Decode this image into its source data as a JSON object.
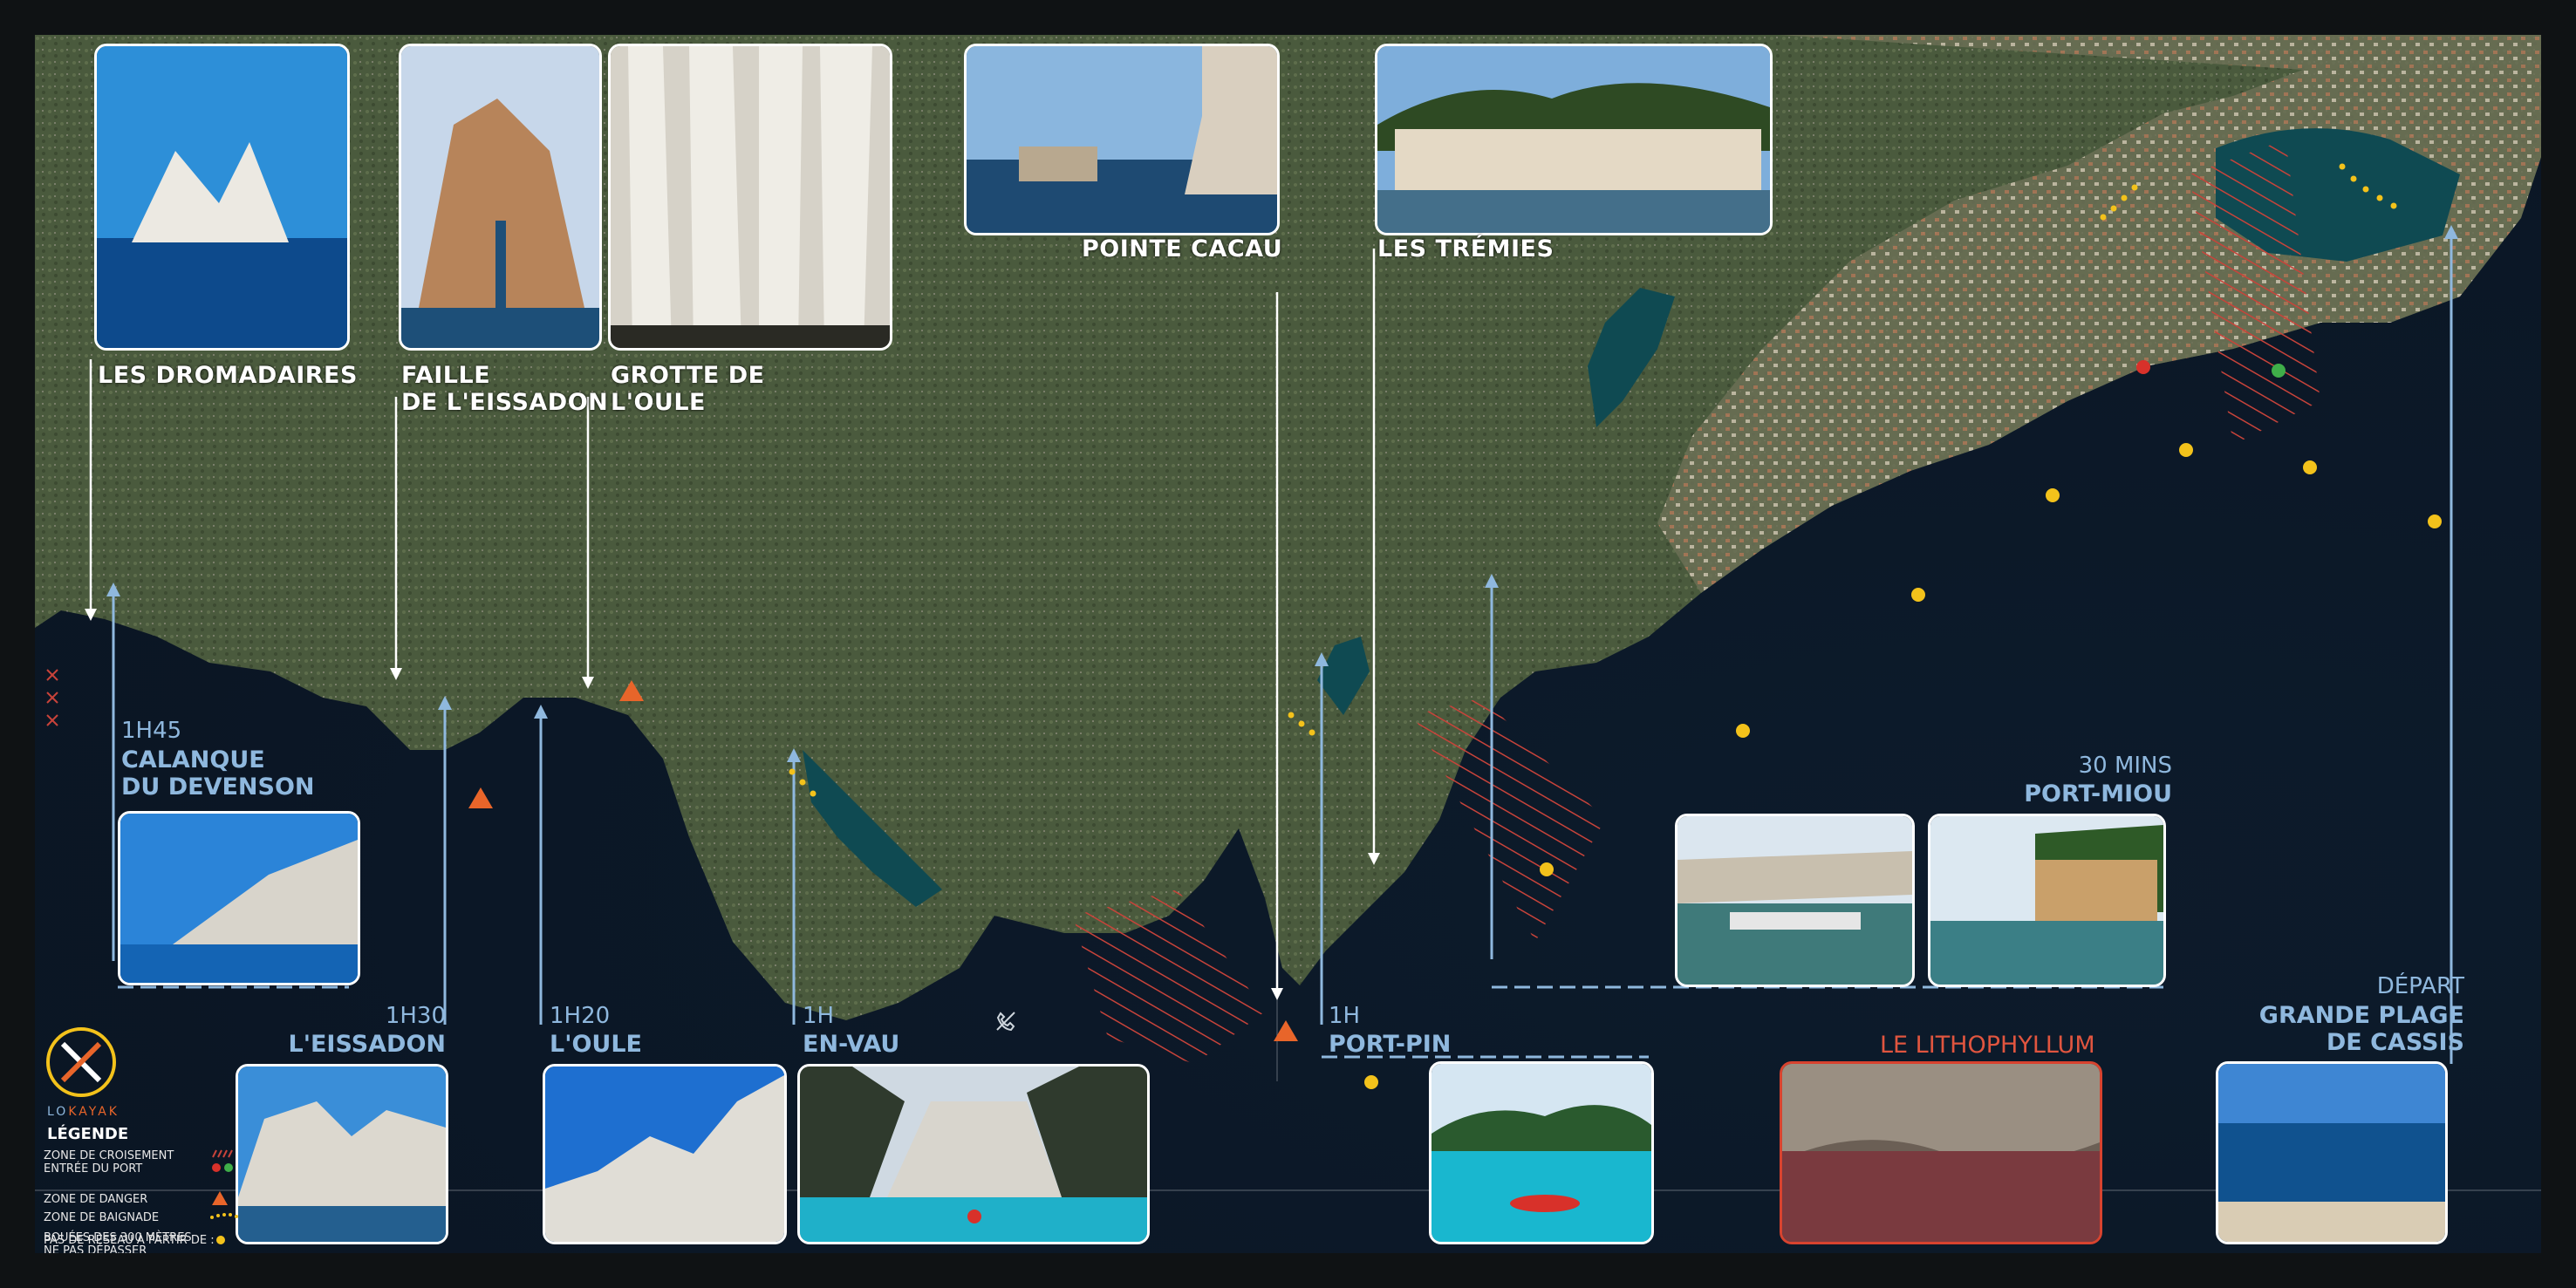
{
  "photos_top": [
    {
      "id": "dromadaires",
      "title": "LES DROMADAIRES"
    },
    {
      "id": "eissadon-faille",
      "title": "FAILLE\nDE L'EISSADON"
    },
    {
      "id": "oule-grotte",
      "title": "GROTTE DE\nL'OULE"
    },
    {
      "id": "cacau",
      "title": "POINTE CACAU"
    },
    {
      "id": "tremies",
      "title": "LES TRÉMIES"
    }
  ],
  "routes": [
    {
      "id": "devenson",
      "time": "1H45",
      "name": "CALANQUE\nDU DEVENSON"
    },
    {
      "id": "eissadon",
      "time": "1H30",
      "name": "L'EISSADON"
    },
    {
      "id": "oule",
      "time": "1H20",
      "name": "L'OULE"
    },
    {
      "id": "envau",
      "time": "1H",
      "name": "EN-VAU"
    },
    {
      "id": "portpin",
      "time": "1H",
      "name": "PORT-PIN"
    },
    {
      "id": "portmiou",
      "time": "30 MINS",
      "name": "PORT-MIOU"
    },
    {
      "id": "depart",
      "time": "DÉPART",
      "name": "GRANDE PLAGE\nDE CASSIS"
    }
  ],
  "lithophyllum": {
    "title": "LE LITHOPHYLLUM"
  },
  "legend": {
    "logo_text_a": "LO",
    "logo_text_b": "KAYAK",
    "title": "LÉGENDE",
    "rows": [
      {
        "label": "ZONE DE CROISEMENT\nENTRÉE DU PORT",
        "mark": "hatch-dots"
      },
      {
        "label": "ZONE DE DANGER",
        "mark": "triangle"
      },
      {
        "label": "ZONE DE BAIGNADE",
        "mark": "dotted"
      },
      {
        "label": "BOUÉES DES 300 MÈTRES\nNE PAS DÉPASSER",
        "mark": "buoy"
      },
      {
        "label": "PAS DE RÉSEAU À PARTIR DE :",
        "mark": "no-network"
      }
    ]
  },
  "colors": {
    "sea": "#0b1726",
    "route": "#8fb8de",
    "danger": "#e8652a",
    "hatch": "#c8433a",
    "buoy": "#f3c21b",
    "dotted": "#f3c21b",
    "green": "#3fae49",
    "red": "#d8312a"
  }
}
